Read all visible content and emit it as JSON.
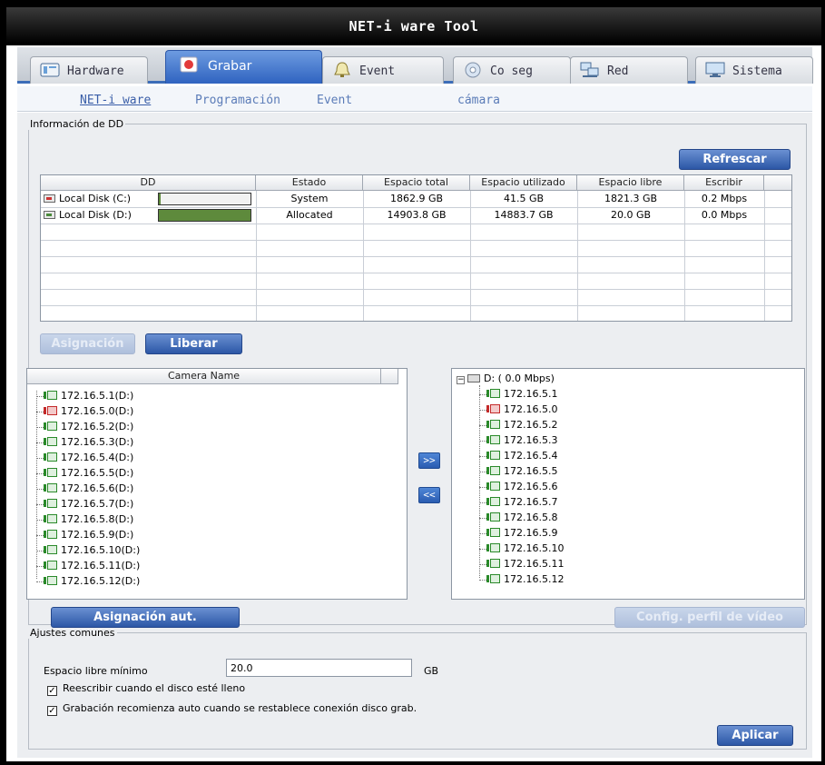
{
  "window": {
    "title": "NET-i ware Tool"
  },
  "tabs": [
    {
      "label": "Hardware",
      "icon": "hardware-icon",
      "active": false
    },
    {
      "label": "Grabar",
      "icon": "record-icon",
      "active": true
    },
    {
      "label": "Event",
      "icon": "bell-icon",
      "active": false
    },
    {
      "label": "Co seg",
      "icon": "disc-icon",
      "active": false
    },
    {
      "label": "Red",
      "icon": "network-icon",
      "active": false
    },
    {
      "label": "Sistema",
      "icon": "monitor-icon",
      "active": false
    }
  ],
  "subnav": [
    {
      "label": "NET-i ware",
      "active": true
    },
    {
      "label": "Programación",
      "active": false
    },
    {
      "label": "Event",
      "active": false
    },
    {
      "label": "cámara",
      "active": false
    }
  ],
  "hdd": {
    "legend": "Información de DD",
    "refresh_label": "Refrescar",
    "columns": [
      "DD",
      "Estado",
      "Espacio total",
      "Espacio utilizado",
      "Espacio libre",
      "Escribir"
    ],
    "rows": [
      {
        "name": "Local Disk (C:)",
        "usage": 0.02,
        "status": "System",
        "total": "1862.9 GB",
        "used": "41.5 GB",
        "free": "1821.3 GB",
        "write": "0.2 Mbps"
      },
      {
        "name": "Local Disk (D:)",
        "usage": 1.0,
        "status": "Allocated",
        "total": "14903.8 GB",
        "used": "14883.7 GB",
        "free": "20.0 GB",
        "write": "0.0 Mbps"
      }
    ],
    "assign_label": "Asignación",
    "release_label": "Liberar",
    "camera_column": "Camera Name",
    "cameras": [
      "172.16.5.1(D:)",
      "172.16.5.0(D:)",
      "172.16.5.2(D:)",
      "172.16.5.3(D:)",
      "172.16.5.4(D:)",
      "172.16.5.5(D:)",
      "172.16.5.6(D:)",
      "172.16.5.7(D:)",
      "172.16.5.8(D:)",
      "172.16.5.9(D:)",
      "172.16.5.10(D:)",
      "172.16.5.11(D:)",
      "172.16.5.12(D:)"
    ],
    "move_right": ">>",
    "move_left": "<<",
    "tree_root": "D: ( 0.0 Mbps)",
    "tree_items": [
      "172.16.5.1",
      "172.16.5.0",
      "172.16.5.2",
      "172.16.5.3",
      "172.16.5.4",
      "172.16.5.5",
      "172.16.5.6",
      "172.16.5.7",
      "172.16.5.8",
      "172.16.5.9",
      "172.16.5.10",
      "172.16.5.11",
      "172.16.5.12"
    ],
    "auto_assign_label": "Asignación aut.",
    "video_profile_label": "Config. perfil de vídeo"
  },
  "common": {
    "legend": "Ajustes comunes",
    "min_free_label": "Espacio libre mínimo",
    "min_free_value": "20.0",
    "min_free_unit": "GB",
    "overwrite_label": "Reescribir cuando el disco esté lleno",
    "overwrite_checked": true,
    "auto_restart_label": "Grabación recomienza auto  cuando se restablece conexión disco grab.",
    "auto_restart_checked": true,
    "apply_label": "Aplicar"
  },
  "colors": {
    "accent": "#2f63c0",
    "disk_fill": "#5e8a3c",
    "camera_ok": "#2a8a2a",
    "camera_error": "#c42a2a"
  }
}
